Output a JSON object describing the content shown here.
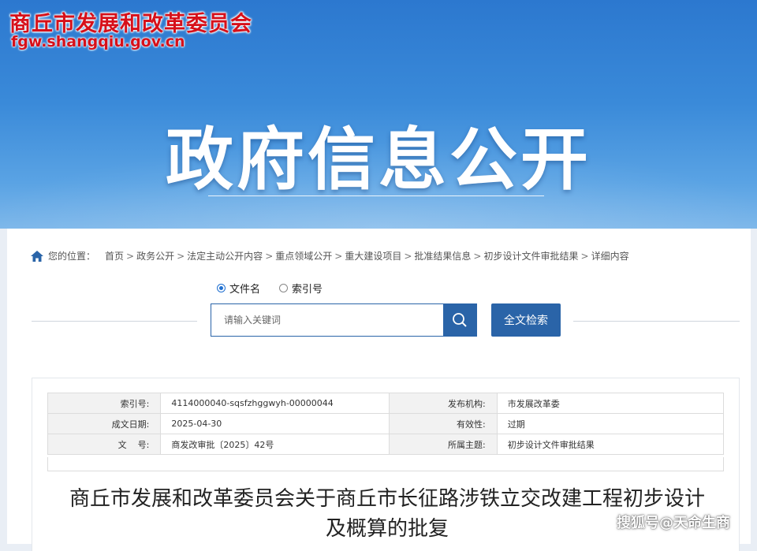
{
  "header": {
    "site_name": "商丘市发展和改革委员会",
    "site_domain": "fgw.shangqiu.gov.cn",
    "banner_title": "政府信息公开"
  },
  "breadcrumb": {
    "label": "您的位置：",
    "items": [
      "首页",
      "政务公开",
      "法定主动公开内容",
      "重点领域公开",
      "重大建设项目",
      "批准结果信息",
      "初步设计文件审批结果",
      "详细内容"
    ],
    "separator": ">"
  },
  "search": {
    "options": [
      {
        "label": "文件名",
        "selected": true
      },
      {
        "label": "索引号",
        "selected": false
      }
    ],
    "placeholder": "请输入关键词",
    "full_text_button": "全文检索"
  },
  "document": {
    "meta": {
      "index_label": "索引号:",
      "index_value": "4114000040-sqsfzhggwyh-00000044",
      "publisher_label": "发布机构:",
      "publisher_value": "市发展改革委",
      "date_label": "成文日期:",
      "date_value": "2025-04-30",
      "validity_label": "有效性:",
      "validity_value": "过期",
      "docno_label": "文    号:",
      "docno_value": "商发改审批〔2025〕42号",
      "topic_label": "所属主题:",
      "topic_value": "初步设计文件审批结果"
    },
    "title": "商丘市发展和改革委员会关于商丘市长征路涉铁立交改建工程初步设计及概算的批复"
  },
  "watermark": "搜狐号@天命生商",
  "colors": {
    "brand_red": "#d6101a",
    "primary_blue": "#2a64a8",
    "banner_blue": "#3a8ad9"
  }
}
